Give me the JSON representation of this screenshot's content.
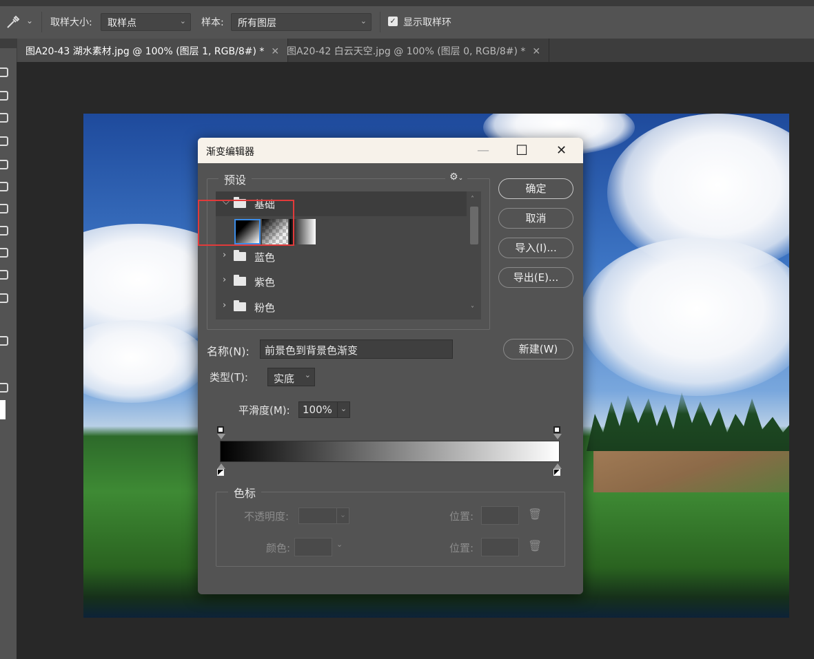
{
  "options_bar": {
    "sample_size_label": "取样大小:",
    "sample_size_value": "取样点",
    "sample_label": "样本:",
    "sample_value": "所有图层",
    "show_ring_label": "显示取样环"
  },
  "tabs": [
    {
      "label": "图A20-43 湖水素材.jpg @ 100% (图层 1, RGB/8#) *",
      "active": true
    },
    {
      "label": "图A20-42 白云天空.jpg @ 100% (图层 0, RGB/8#) *",
      "active": false
    }
  ],
  "dialog": {
    "title": "渐变编辑器",
    "presets_label": "预设",
    "groups": [
      {
        "name": "基础",
        "expanded": true
      },
      {
        "name": "蓝色",
        "expanded": false
      },
      {
        "name": "紫色",
        "expanded": false
      },
      {
        "name": "粉色",
        "expanded": false
      }
    ],
    "buttons": {
      "ok": "确定",
      "cancel": "取消",
      "import": "导入(I)...",
      "export": "导出(E)...",
      "new": "新建(W)"
    },
    "name_label": "名称(N):",
    "name_value": "前景色到背景色渐变",
    "type_label": "类型(T):",
    "type_value": "实底",
    "smooth_label": "平滑度(M):",
    "smooth_value": "100%",
    "color_stops": {
      "section_label": "色标",
      "opacity_label": "不透明度:",
      "position_label": "位置:",
      "color_label": "颜色:",
      "position_label_2": "位置:"
    }
  },
  "colors": {
    "dialog_bg": "#535353",
    "title_bar": "#f7f2ea",
    "highlight_box": "#e23a3a",
    "gradient_start": "#000000",
    "gradient_end": "#ffffff"
  }
}
